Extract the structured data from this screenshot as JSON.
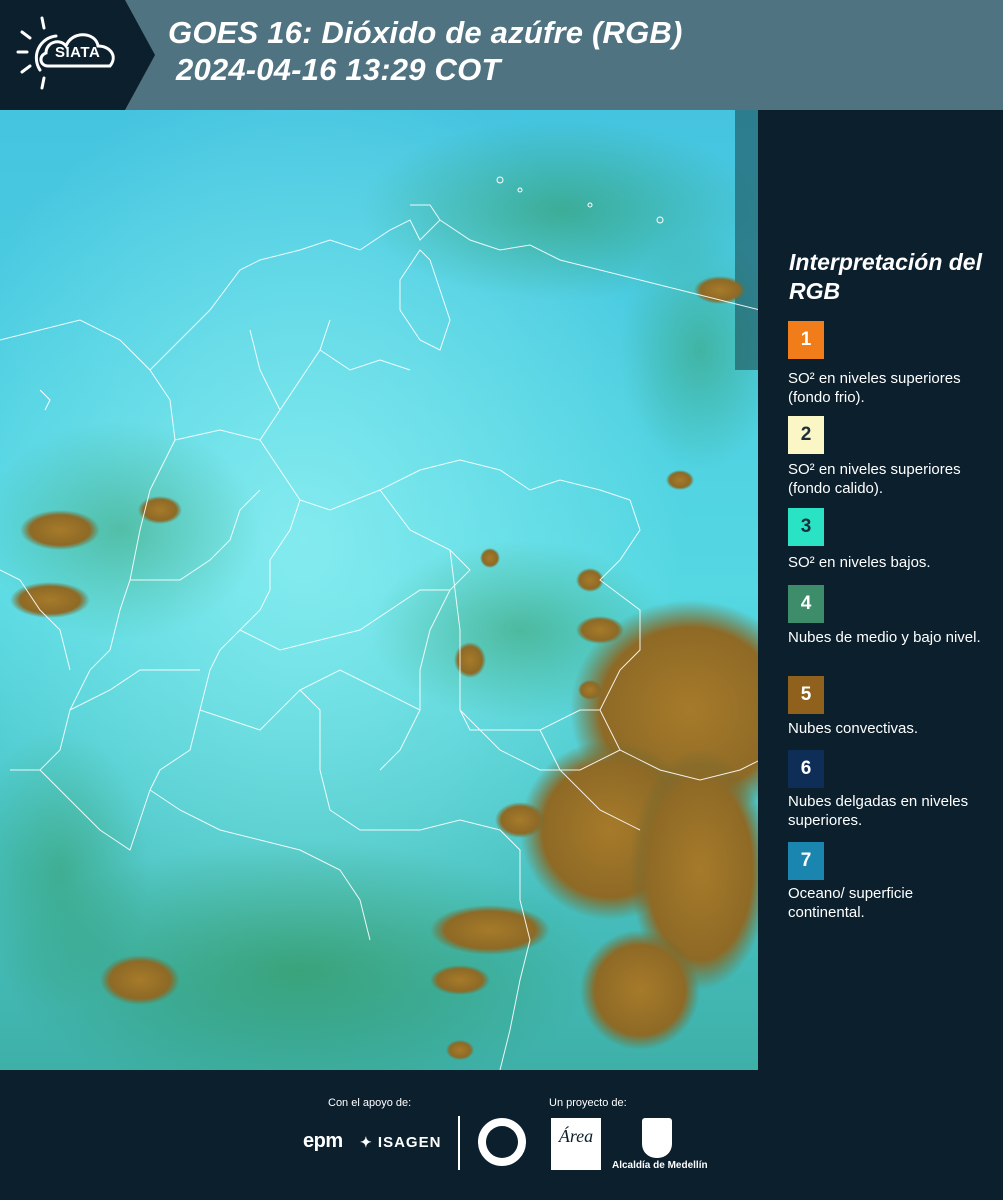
{
  "header": {
    "logo_text": "SIATA",
    "title_line1": "GOES 16: Dióxido de azúfre (RGB)",
    "title_line2": "2024-04-16 13:29 COT",
    "bg_color": "#4f7381"
  },
  "legend": {
    "title": "Interpretación del RGB",
    "items": [
      {
        "num": "1",
        "color": "#f07c1a",
        "text": "SO² en niveles superiores (fondo frio)."
      },
      {
        "num": "2",
        "color": "#fbf6c6",
        "text": "SO² en niveles superiores (fondo calido)."
      },
      {
        "num": "3",
        "color": "#2ae2c4",
        "text": "SO² en niveles bajos."
      },
      {
        "num": "4",
        "color": "#3d8d6a",
        "text": "Nubes de medio y bajo nivel."
      },
      {
        "num": "5",
        "color": "#8f611c",
        "text": "Nubes convectivas."
      },
      {
        "num": "6",
        "color": "#0e2d57",
        "text": "Nubes delgadas en niveles superiores."
      },
      {
        "num": "7",
        "color": "#1a86b0",
        "text": "Oceano/ superficie continental."
      }
    ]
  },
  "footer": {
    "support_label": "Con el apoyo de:",
    "project_label": "Un proyecto de:",
    "sponsor_1": "epm",
    "sponsor_2": "ISAGEN",
    "partner_2": "Área",
    "partner_3": "Alcaldía de Medellín"
  },
  "colors": {
    "page_bg": "#0b1f2d",
    "ocean": "#33b5d4",
    "land_cyan": "#5fe0e8",
    "cloud_green": "#3c9a5e",
    "convective": "#9b7128",
    "border": "#ffffff"
  }
}
